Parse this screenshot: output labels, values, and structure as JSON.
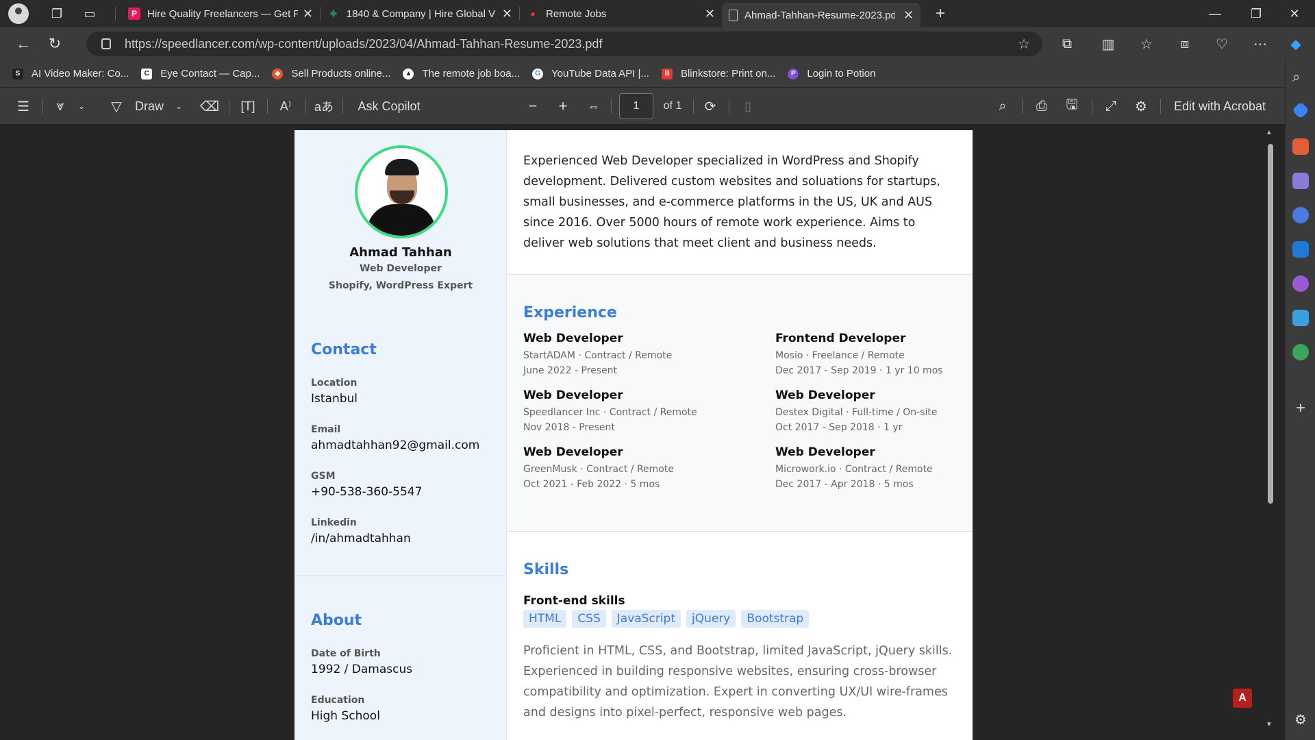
{
  "tabs": [
    {
      "label": "Hire Quality Freelancers — Get F",
      "icon": "freelancer-p-icon",
      "color": "#e8155d"
    },
    {
      "label": "1840 & Company | Hire Global V",
      "icon": "company-logo-icon",
      "color": "#2e8b57"
    },
    {
      "label": "Remote Jobs",
      "icon": "map-pin-icon",
      "color": "#e53935"
    },
    {
      "label": "Ahmad-Tahhan-Resume-2023.pd",
      "icon": "document-icon",
      "color": "#cccccc"
    }
  ],
  "address": {
    "url": "https://speedlancer.com/wp-content/uploads/2023/04/Ahmad-Tahhan-Resume-2023.pdf"
  },
  "bookmarks": [
    {
      "label": "AI Video Maker: Co...",
      "icon": "synthesia-icon",
      "color": "#222222"
    },
    {
      "label": "Eye Contact — Cap...",
      "icon": "captions-icon",
      "color": "#111111"
    },
    {
      "label": "Sell Products online...",
      "icon": "shop-icon",
      "color": "#e4572e"
    },
    {
      "label": "The remote job boa...",
      "icon": "remote-icon",
      "color": "#ffffff"
    },
    {
      "label": "YouTube Data API |...",
      "icon": "google-icon",
      "color": "#ffffff"
    },
    {
      "label": "Blinkstore: Print on...",
      "icon": "blinkstore-icon",
      "color": "#e53935"
    },
    {
      "label": "Login to Potion",
      "icon": "potion-icon",
      "color": "#7b4fd6"
    }
  ],
  "pdf_toolbar": {
    "draw_label": "Draw",
    "ask_copilot": "Ask Copilot",
    "page_current": "1",
    "page_total": "of 1",
    "edit_acrobat": "Edit with Acrobat"
  },
  "resume": {
    "name": "Ahmad Tahhan",
    "title": "Web Developer",
    "subtitle": "Shopify, WordPress Expert",
    "contact_heading": "Contact",
    "contact": [
      {
        "label": "Location",
        "value": "Istanbul"
      },
      {
        "label": "Email",
        "value": "ahmadtahhan92@gmail.com"
      },
      {
        "label": "GSM",
        "value": "+90-538-360-5547"
      },
      {
        "label": "Linkedin",
        "value": "/in/ahmadtahhan"
      }
    ],
    "about_heading": "About",
    "about": [
      {
        "label": "Date of Birth",
        "value": "1992 / Damascus"
      },
      {
        "label": "Education",
        "value": "High School"
      }
    ],
    "summary": "Experienced Web Developer specialized in WordPress and Shopify development. Delivered custom websites and soluations for startups, small businesses, and e-commerce platforms in the US, UK and AUS since 2016. Over 5000 hours of remote work experience. Aims to deliver web solutions that meet client and business needs.",
    "experience_heading": "Experience",
    "experience": [
      {
        "title": "Web Developer",
        "company": "StartADAM · Contract / Remote",
        "dates": "June 2022 - Present"
      },
      {
        "title": "Frontend Developer",
        "company": "Mosio · Freelance / Remote",
        "dates": "Dec 2017 - Sep 2019 · 1 yr 10 mos"
      },
      {
        "title": "Web Developer",
        "company": "Speedlancer Inc · Contract / Remote",
        "dates": "Nov 2018 - Present"
      },
      {
        "title": "Web Developer",
        "company": "Destex Digital · Full-time / On-site",
        "dates": "Oct 2017 - Sep 2018 · 1 yr"
      },
      {
        "title": "Web Developer",
        "company": "GreenMusk · Contract / Remote",
        "dates": "Oct 2021 - Feb 2022 · 5 mos"
      },
      {
        "title": "Web Developer",
        "company": "Microwork.io · Contract / Remote",
        "dates": "Dec 2017 - Apr 2018 · 5 mos"
      }
    ],
    "skills_heading": "Skills",
    "frontend_heading": "Front-end skills",
    "tags": [
      "HTML",
      "CSS",
      "JavaScript",
      "jQuery",
      "Bootstrap"
    ],
    "skills_text": "Proficient in HTML, CSS, and Bootstrap, limited JavaScript, jQuery skills. Experienced in building responsive websites, ensuring cross-browser compatibility and optimization. Expert in converting UX/UI wire-frames and designs into pixel-perfect, responsive web pages."
  },
  "colors": {
    "accent": "#3b7dd8",
    "avatar_ring": "#3ddc84",
    "acrobat": "#b5201c"
  }
}
